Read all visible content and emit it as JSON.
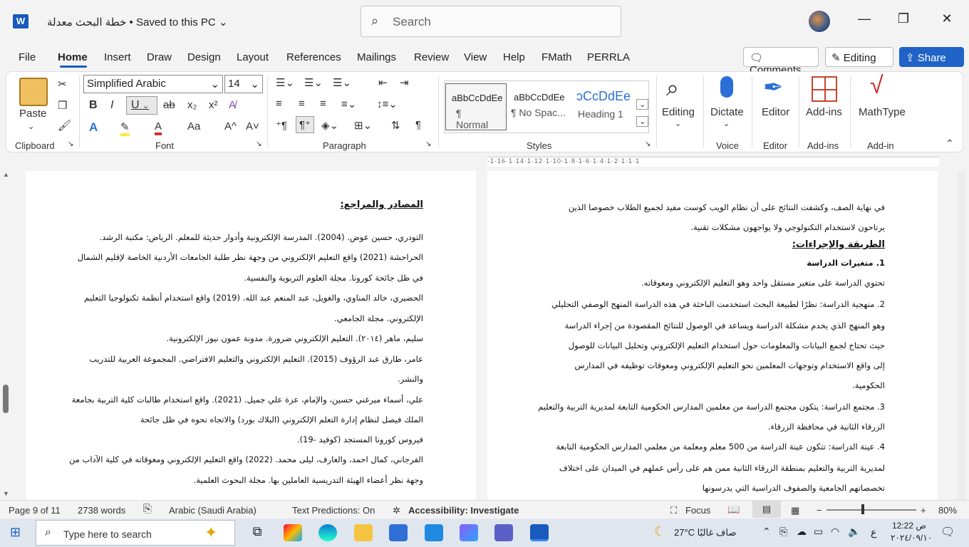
{
  "titlebar": {
    "app_icon": "W",
    "doc_title": "خطة البحث معدلة • Saved to this PC",
    "search_placeholder": "Search",
    "min": "—",
    "restore": "❐",
    "close": "✕"
  },
  "menu": {
    "tabs": [
      "File",
      "Home",
      "Insert",
      "Draw",
      "Design",
      "Layout",
      "References",
      "Mailings",
      "Review",
      "View",
      "Help",
      "FMath",
      "PERRLA"
    ],
    "comments": "Comments",
    "editing": "Editing",
    "share": "Share"
  },
  "ribbon": {
    "clipboard": {
      "paste": "Paste",
      "label": "Clipboard"
    },
    "font": {
      "name": "Simplified Arabic",
      "size": "14",
      "label": "Font",
      "bold": "B",
      "italic": "I",
      "underline": "U",
      "strike": "ab",
      "sub": "x₂",
      "sup": "x²",
      "case": "Aa",
      "grow": "A^",
      "shrink": "A˅"
    },
    "paragraph": {
      "label": "Paragraph",
      "pilcrow": "¶"
    },
    "styles": {
      "label": "Styles",
      "items": [
        {
          "preview": "aBbCcDdEe",
          "name": "¶ Normal"
        },
        {
          "preview": "aBbCcDdEe",
          "name": "¶ No Spac..."
        },
        {
          "preview": "ɔCcDdEe",
          "name": "Heading 1"
        }
      ]
    },
    "editing": {
      "label": "Editing"
    },
    "voice": {
      "dictate": "Dictate",
      "label": "Voice"
    },
    "editor": {
      "button": "Editor",
      "label": "Editor"
    },
    "addins": {
      "button": "Add-ins",
      "label": "Add-ins"
    },
    "mathtype": {
      "button": "MathType",
      "label": "Add-in"
    }
  },
  "ruler": {
    "text": "·1·16·1·14·1·12·1·10·1·8·1·6·1·4·1·2·1·1·1"
  },
  "left_page": {
    "lines": [
      "المصادر والمراجع:",
      "التودري، حسين عوض. (2004). المدرسة الإلكترونية وأدوار حديثة للمعلم. الرياض: مكتبة الرشد.",
      "الحراحشة (2021) واقع التعليم الإلكتروني من وجهة نظر طلبة الجامعات الأردنية الخاصة لإقليم الشمال",
      "في ظل جائحة كورونا. مجلة العلوم التربوية والنفسية.",
      "الحضيري، خالد المناوي، والغويل، عبد المنعم عبد الله. (2019) واقع استخدام أنظمة تكنولوجيا التعليم",
      "الإلكتروني. مجلة الجامعي.",
      "سليم، ماهر (٢٠١٤). التعليم الإلكتروني ضرورة. مدونة عمون نيوز الإلكترونية.",
      "عامر، طارق عبد الرؤوف (2015). التعليم الإلكتروني والتعليم الافتراضي. المجموعة العربية للتدريب",
      "والنشر.",
      "علي، أسماء ميرغني حسين، والإمام، عزة علي جميل. (2021). واقع استخدام طالبات كلية التربية بجامعة",
      "الملك فيصل لنظام إدارة التعلم الإلكتروني (البلاك بورد) والاتجاه نحوه في ظل جائحة",
      "فيروس كورونا المستجد (كوفيد -19).",
      "الفرجاني، كمال احمد، والعارف، ليلى محمد. (2022) واقع التعليم الإلكتروني ومعوقاته في كلية الآداب من",
      "وجهة نظر أعضاء الهيئة التدريسية العاملين بها. مجلة البحوث العلمية."
    ]
  },
  "right_page": {
    "lines": [
      "في نهاية الصف، وكشفت النتائج على أن نظام الويب كوست مفيد لجميع الطلاب خصوصا الذين",
      "يرتاحون لاستخدام التكنولوجي ولا يواجهون مشكلات تقنية.",
      "الطريقة والإجراءات:",
      "1. متغيرات الدراسة",
      "تحتوي الدراسة على متغير مستقل واحد وهو التعليم الإلكتروني ومعوقاته.",
      "2. منهجية الدراسة: نظرًا لطبيعة البحث استخدمت الباحثة في هذه الدراسة المنهج الوصفي التحليلي",
      "وهو المنهج الذي يخدم مشكلة الدراسة ويساعد في الوصول للنتائج المقصودة من إجراء الدراسة",
      "حيث تحتاج لجمع البيانات والمعلومات حول استخدام التعليم الإلكتروني وتحليل البيانات للوصول",
      "إلى واقع الاستخدام وتوجهات المعلمين نحو التعليم الإلكتروني ومعوقات توظيفه في المدارس",
      "الحكومية.",
      "3. مجتمع الدراسة: يتكون مجتمع الدراسة من معلمين المدارس الحكومية التابعة لمديرية التربية والتعليم",
      "الزرقاء الثانية في محافظة الزرقاء.",
      "4. عينة الدراسة: تتكون عينة الدراسة من 500 معلم ومعلمة من معلمي المدارس الحكومية التابعة",
      "لمديرية التربية والتعليم بمنطقة الزرقاء الثانية ممن هم على رأس عملهم في الميدان على اختلاف",
      "تخصصاتهم الجامعية والصفوف الدراسية التي يدرسونها"
    ]
  },
  "status": {
    "page": "Page 9 of 11",
    "words": "2738 words",
    "language": "Arabic (Saudi Arabia)",
    "predictions": "Text Predictions: On",
    "accessibility": "Accessibility: Investigate",
    "focus": "Focus",
    "zoom": "80%"
  },
  "taskbar": {
    "search": "Type here to search",
    "weather": "27°C  صاف غالبًا",
    "lang": "ع",
    "time": "12:22 ص",
    "date": "٢٠٢٤/٠٩/١٠"
  }
}
